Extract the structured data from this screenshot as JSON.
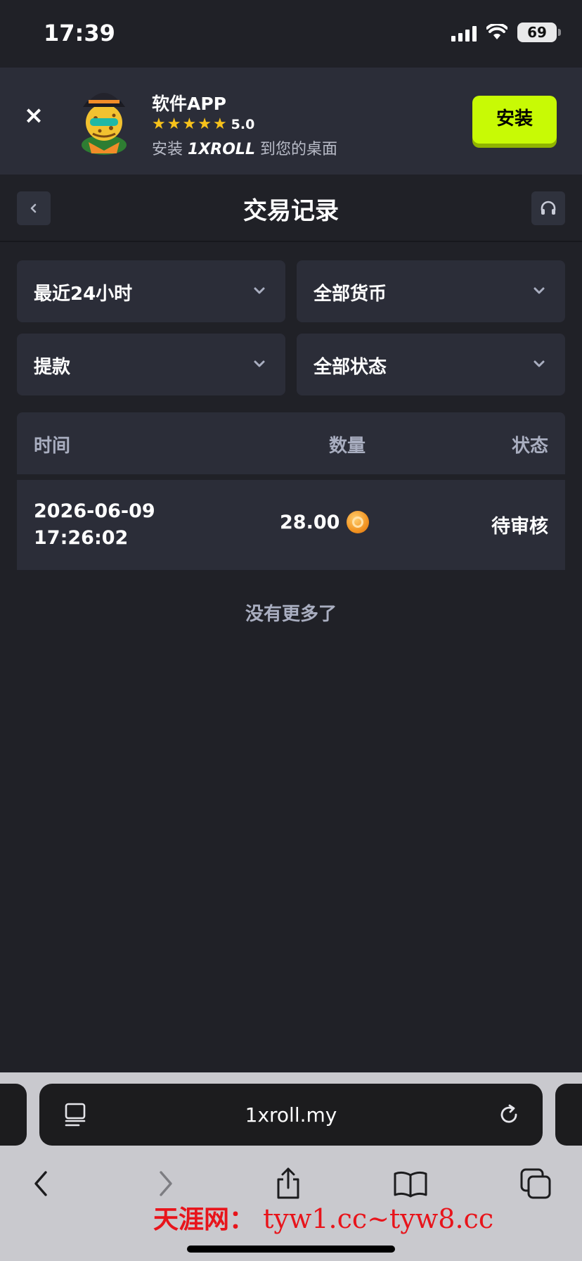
{
  "status_bar": {
    "time": "17:39",
    "battery": "69"
  },
  "banner": {
    "close_symbol": "×",
    "title": "软件APP",
    "stars": [
      "★",
      "★",
      "★",
      "★",
      "★"
    ],
    "rating": "5.0",
    "desc_prefix": "安装",
    "desc_brand": "1XROLL",
    "desc_suffix": "到您的桌面",
    "install_label": "安装",
    "accent_color": "#c8fa05"
  },
  "header": {
    "title": "交易记录"
  },
  "filters": {
    "period": "最近24小时",
    "currency": "全部货币",
    "type": "提款",
    "status": "全部状态"
  },
  "table": {
    "headers": {
      "time": "时间",
      "amount": "数量",
      "status": "状态"
    },
    "rows": [
      {
        "date": "2026-06-09",
        "time": "17:26:02",
        "amount": "28.00",
        "status": "待审核"
      }
    ]
  },
  "no_more": "没有更多了",
  "browser": {
    "url": "1xroll.my"
  },
  "watermark": {
    "cn": "天涯网：",
    "en": "tyw1.cc~tyw8.cc"
  }
}
